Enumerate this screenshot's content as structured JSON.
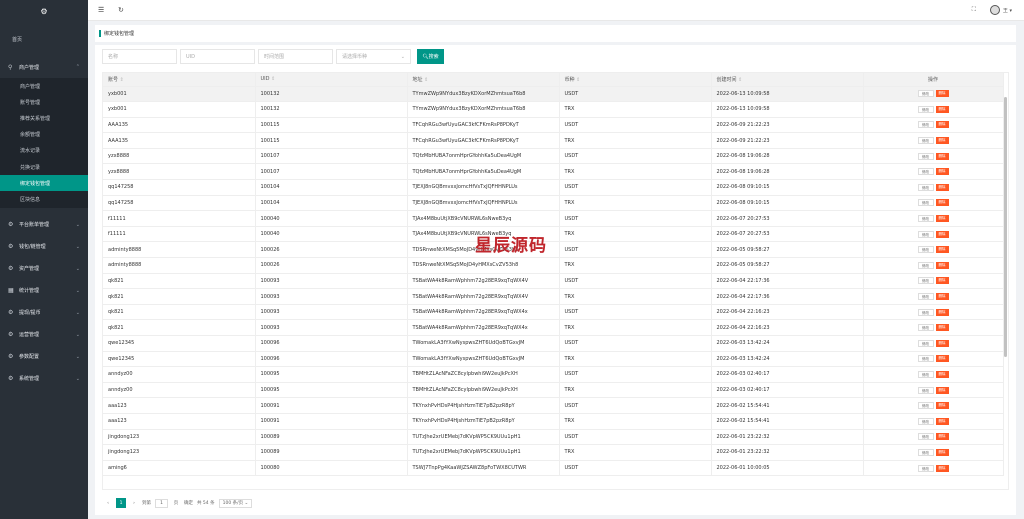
{
  "sidebar": {
    "logo_icon": "gear-icon",
    "home": "首页",
    "groups": [
      {
        "label": "商户管理",
        "icon": "user-icon",
        "expanded": true,
        "items": [
          "商户管理",
          "账号管理",
          "推荐关系管理",
          "余额管理",
          "流水记录",
          "兑换记录",
          "绑定钱包管理",
          "区块信息"
        ],
        "active_index": 6
      },
      {
        "label": "平台账单管理",
        "icon": "gear-icon"
      },
      {
        "label": "钱包/链管理",
        "icon": "gear-icon"
      },
      {
        "label": "资产管理",
        "icon": "gear-icon"
      },
      {
        "label": "统计管理",
        "icon": "chart-icon"
      },
      {
        "label": "提现/提币",
        "icon": "gear-icon"
      },
      {
        "label": "运营管理",
        "icon": "gear-icon"
      },
      {
        "label": "参数配置",
        "icon": "gear-icon"
      },
      {
        "label": "系统管理",
        "icon": "gear-icon"
      }
    ]
  },
  "topbar": {
    "user_name": "王 ▾"
  },
  "page": {
    "title": "绑定钱包管理"
  },
  "filters": {
    "name_placeholder": "名称",
    "uid_placeholder": "UID",
    "time_placeholder": "时间范围",
    "currency_placeholder": "请选择币种",
    "search_label": "搜索"
  },
  "table": {
    "headers": [
      "账号",
      "UID",
      "地址",
      "币种",
      "创建时间",
      "操作"
    ],
    "edit_label": "修改",
    "delete_label": "删除",
    "rows": [
      [
        "yxb001",
        "100132",
        "TYmwZWp9NYdux3BzyKDXorMZhmtsuaT6b8",
        "USDT",
        "2022-06-13 10:09:58"
      ],
      [
        "yxb001",
        "100132",
        "TYmwZWp9NYdux3BzyKDXorMZhmtsuaT6b8",
        "TRX",
        "2022-06-13 10:09:58"
      ],
      [
        "AAA135",
        "100115",
        "TFCqhRGu3wfUyuGAC3kfCFKmRsP8PDKyT",
        "USDT",
        "2022-06-09 21:22:23"
      ],
      [
        "AAA135",
        "100115",
        "TFCqhRGu3wfUyuGAC3kfCFKmRsP8PDKyT",
        "TRX",
        "2022-06-09 21:22:23"
      ],
      [
        "yzx8888",
        "100107",
        "TQfzMbHUBA7onmHprGYohhKa5uDea4UgM",
        "USDT",
        "2022-06-08 19:06:28"
      ],
      [
        "yzx8888",
        "100107",
        "TQfzMbHUBA7onmHprGYohhKa5uDea4UgM",
        "TRX",
        "2022-06-08 19:06:28"
      ],
      [
        "qq147258",
        "100104",
        "TJEXJ8nGQBmvxxJomcHfVsTxJQFHHNPLUs",
        "USDT",
        "2022-06-08 09:10:15"
      ],
      [
        "qq147258",
        "100104",
        "TJEXJ8nGQBmvxxJomcHfVsTxJQFHHNPLUs",
        "TRX",
        "2022-06-08 09:10:15"
      ],
      [
        "f11111",
        "100040",
        "TJAx4M8buUtjXB9cVNURWL6sNweB3yq",
        "USDT",
        "2022-06-07 20:27:53"
      ],
      [
        "f11111",
        "100040",
        "TJAx4M8buUtjXB9cVNURWL6sNweB3yq",
        "TRX",
        "2022-06-07 20:27:53"
      ],
      [
        "adminty8888",
        "100026",
        "TDSRnweNtXMSq5MoJD4yHMXsCvZV53h8",
        "USDT",
        "2022-06-05 09:58:27"
      ],
      [
        "adminty8888",
        "100026",
        "TDSRnweNtXMSq5MoJD4yHMXsCvZV53h8",
        "TRX",
        "2022-06-05 09:58:27"
      ],
      [
        "qk821",
        "100093",
        "TSBatWA4k8RamWphhm72g28ER9xqTqWX4V",
        "USDT",
        "2022-06-04 22:17:36"
      ],
      [
        "qk821",
        "100093",
        "TSBatWA4k8RamWphhm72g28ER9xqTqWX4V",
        "TRX",
        "2022-06-04 22:17:36"
      ],
      [
        "qk821",
        "100093",
        "TSBatWA4k8RamWphhm72g28ER9xqTqWX4x",
        "USDT",
        "2022-06-04 22:16:23"
      ],
      [
        "qk821",
        "100093",
        "TSBatWA4k8RamWphhm72g28ER9xqTqWX4x",
        "TRX",
        "2022-06-04 22:16:23"
      ],
      [
        "qwe12345",
        "100096",
        "TWomakLA3fYXwNyspwsZHT6UdQoBTGxvJM",
        "USDT",
        "2022-06-03 13:42:24"
      ],
      [
        "qwe12345",
        "100096",
        "TWomakLA3fYXwNyspwsZHT6UdQoBTGxvJM",
        "TRX",
        "2022-06-03 13:42:24"
      ],
      [
        "anndyz00",
        "100095",
        "TBMHtZLAcNFaZC8cylpbwhi9W2euJkPcXH",
        "USDT",
        "2022-06-03 02:40:17"
      ],
      [
        "anndyz00",
        "100095",
        "TBMHtZLAcNFaZC8cylpbwhi9W2euJkPcXH",
        "TRX",
        "2022-06-03 02:40:17"
      ],
      [
        "aaa123",
        "100091",
        "TKYnxhPvHDsP4HjshHzmTiE7pB2pzR8pY",
        "USDT",
        "2022-06-02 15:54:41"
      ],
      [
        "aaa123",
        "100091",
        "TKYnxhPvHDsP4HjshHzmTiE7pB2pzR8pY",
        "TRX",
        "2022-06-02 15:54:41"
      ],
      [
        "jingdong123",
        "100089",
        "TUTzJhe2xrUEMebj7dKVpWP5CK9UUu1pH1",
        "USDT",
        "2022-06-01 23:22:32"
      ],
      [
        "jingdong123",
        "100089",
        "TUTzJhe2xrUEMebj7dKVpWP5CK9UUu1pH1",
        "TRX",
        "2022-06-01 23:22:32"
      ],
      [
        "aming6",
        "100080",
        "TSWJ7TnpPg4KaaWJZSAWZ8pFoTWX8CUTWR",
        "USDT",
        "2022-06-01 10:00:05"
      ]
    ]
  },
  "pager": {
    "prev": "‹",
    "current": "1",
    "next": "›",
    "goto_label": "到第",
    "goto_value": "1",
    "page_unit": "页",
    "confirm_label": "确定",
    "total_label": "共 54 条",
    "page_size": "100 条/页 ⌄"
  },
  "watermark": "星辰源码",
  "colors": {
    "accent": "#009688",
    "danger": "#ff5722",
    "sidebar_bg": "#293038"
  }
}
